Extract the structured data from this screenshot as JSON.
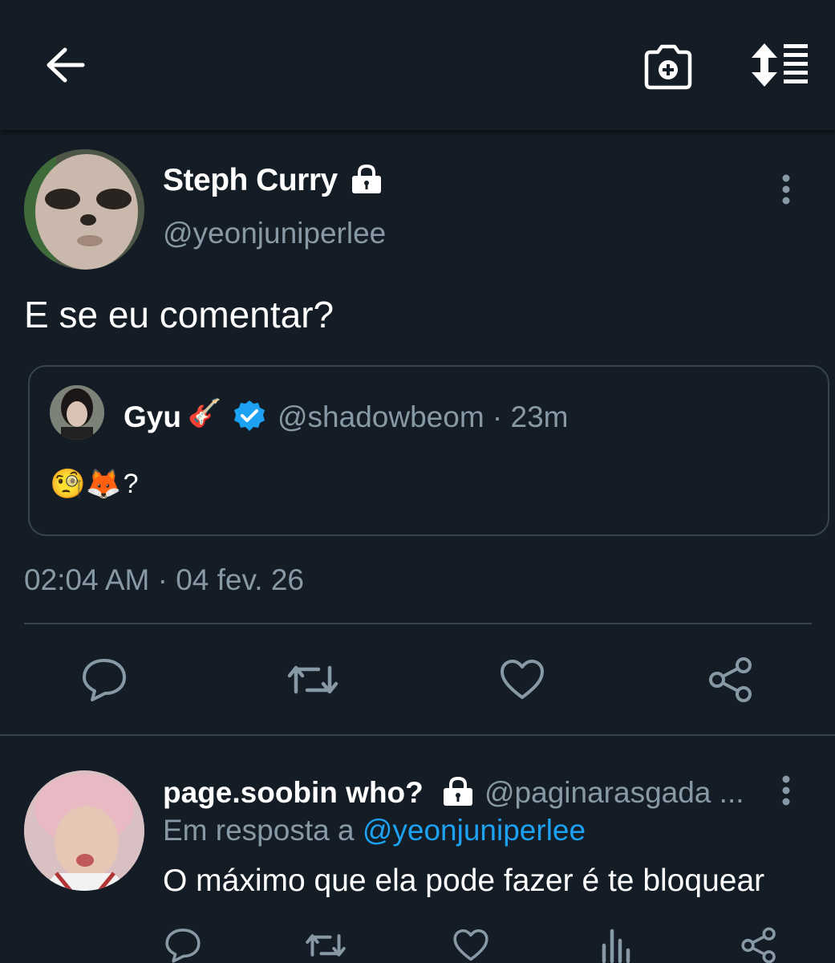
{
  "colors": {
    "background": "#141d26",
    "muted": "#8899a6",
    "accent": "#1da1f2",
    "divider": "#38444d",
    "text": "#ffffff"
  },
  "topbar": {
    "back_icon": "arrow-left-icon",
    "camera_icon": "camera-add-icon",
    "sort_icon": "sort-list-icon"
  },
  "tweet": {
    "name": "Steph Curry",
    "handle": "@yeonjuniperlee",
    "text": "E se eu comentar?",
    "timestamp": "02:04 AM · 04 fev. 26",
    "quote": {
      "name": "Gyu",
      "name_emoji": "🎸",
      "meta": "@shadowbeom · 23m",
      "text_emojis": "🧐🦊",
      "text_suffix": "?"
    }
  },
  "reply": {
    "name": "page.soobin who?",
    "handle": "@paginarasgada ...",
    "reply_prefix": "Em resposta a",
    "reply_to": "@yeonjuniperlee",
    "text": "O máximo que ela pode fazer é te bloquear"
  }
}
